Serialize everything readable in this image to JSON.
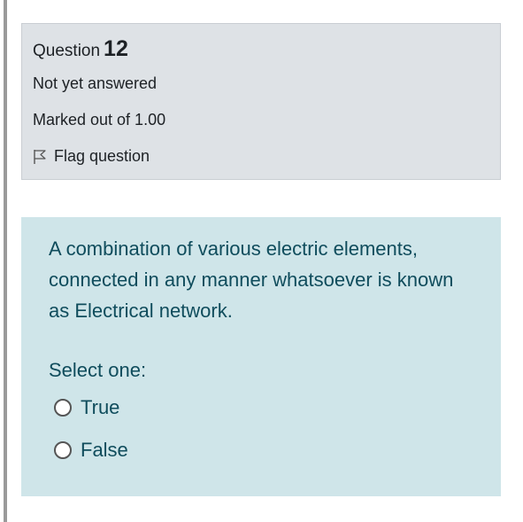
{
  "info": {
    "question_label": "Question",
    "question_number": "12",
    "state": "Not yet answered",
    "grade": "Marked out of 1.00",
    "flag_label": "Flag question",
    "flag_icon": "flag-outline-icon"
  },
  "question": {
    "text": "A combination of various electric elements, connected in any manner whatsoever is known as Electrical network.",
    "prompt": "Select one:",
    "options": [
      {
        "label": "True",
        "selected": false
      },
      {
        "label": "False",
        "selected": false
      }
    ]
  },
  "colors": {
    "info_bg": "#dee2e6",
    "content_bg": "#cfe5e9",
    "question_text": "#0f4c5c"
  }
}
